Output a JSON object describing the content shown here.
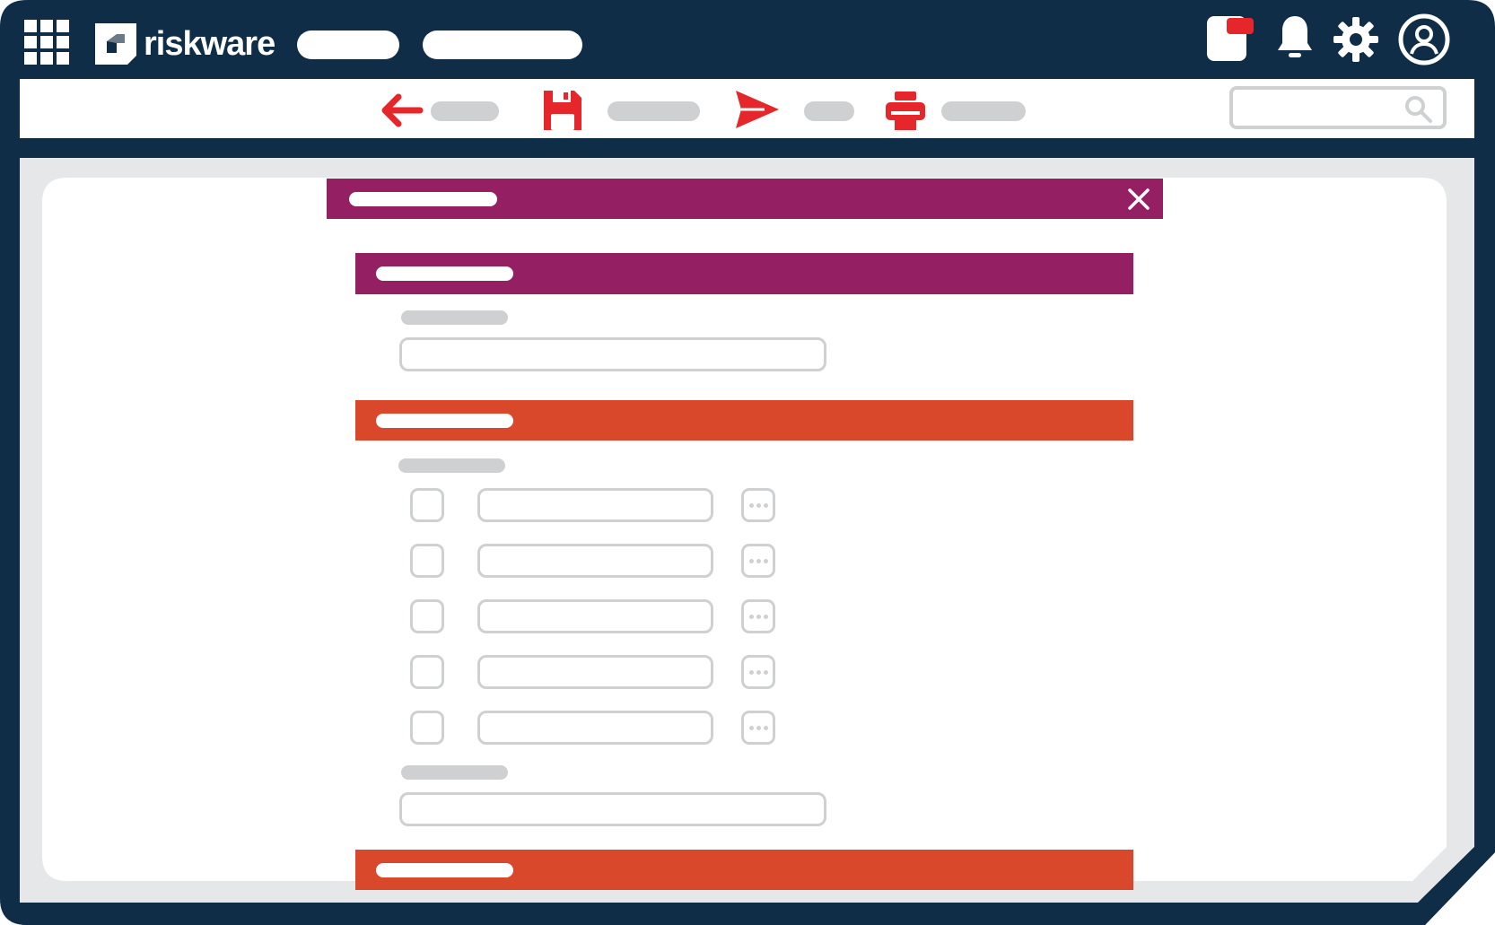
{
  "brand": {
    "name": "riskware"
  },
  "colors": {
    "frame": "#0f2d47",
    "accent_red": "#e5262b",
    "section_purple": "#941f63",
    "section_orange": "#d9482b",
    "placeholder_grey": "#cfd0d1",
    "canvas_grey": "#e6e7e8"
  },
  "icons": {
    "apps": "grid-icon",
    "notifications_app": "app-badge-icon",
    "bell": "bell-icon",
    "settings": "gear-icon",
    "account": "user-circle-icon",
    "back": "arrow-left-icon",
    "save": "floppy-disk-icon",
    "send": "paper-plane-icon",
    "print": "printer-icon",
    "search": "search-icon",
    "close": "close-icon",
    "more": "ellipsis-icon"
  },
  "form": {
    "list_rows": 5
  }
}
